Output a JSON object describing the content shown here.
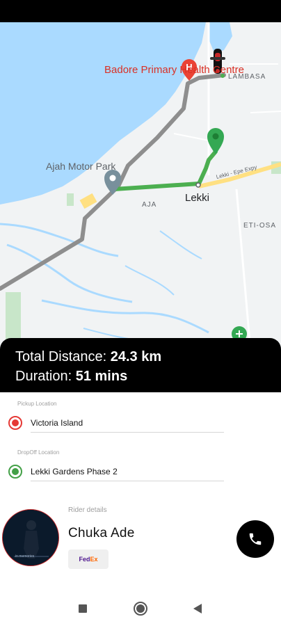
{
  "map": {
    "poi_hospital": "Badore Primary Health Centre",
    "poi_park": "Ajah Motor Park",
    "area_lambasa": "LAMBASA",
    "area_aja": "AJA",
    "area_eti_osa": "ETI-OSA",
    "city_lekki": "Lekki",
    "road_label": "Lekki - Epe Expy"
  },
  "trip": {
    "distance_label": "Total Distance:",
    "distance_value": "24.3 km",
    "duration_label": "Duration:",
    "duration_value": "51 mins"
  },
  "pickup": {
    "label": "Pickup Location",
    "value": "Victoria Island"
  },
  "dropoff": {
    "label": "DropOff Location",
    "value": "Lekki Gardens Phase 2"
  },
  "rider": {
    "section_label": "Rider details",
    "name": "Chuka Ade",
    "company_fed": "Fed",
    "company_ex": "Ex",
    "avatar_caption": "in memories"
  },
  "colors": {
    "route_active": "#4caf50",
    "route_inactive": "#8e8e8e",
    "pickup_marker": "#e53935",
    "dropoff_marker": "#43a047"
  },
  "icons": {
    "call": "phone-icon",
    "nav_recent": "square-icon",
    "nav_home": "circle-icon",
    "nav_back": "triangle-back-icon"
  }
}
